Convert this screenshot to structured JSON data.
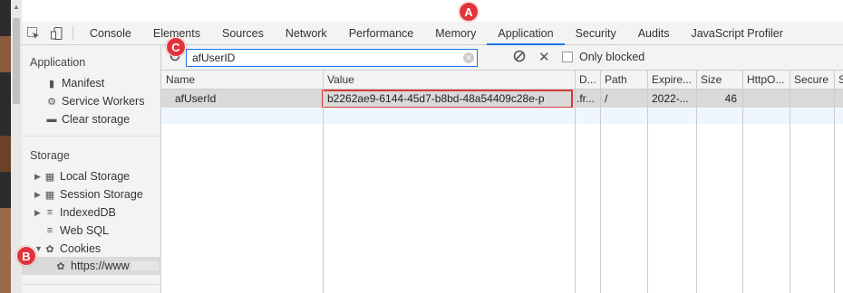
{
  "tabs": [
    "Console",
    "Elements",
    "Sources",
    "Network",
    "Performance",
    "Memory",
    "Application",
    "Security",
    "Audits",
    "JavaScript Profiler"
  ],
  "active_tab": "Application",
  "sidebar": {
    "application_title": "Application",
    "application_items": [
      "Manifest",
      "Service Workers",
      "Clear storage"
    ],
    "storage_title": "Storage",
    "storage_items": [
      "Local Storage",
      "Session Storage",
      "IndexedDB",
      "Web SQL",
      "Cookies"
    ],
    "cookie_origin": "https://www"
  },
  "filter": {
    "value": "afUserID",
    "only_blocked_label": "Only blocked"
  },
  "table": {
    "columns": [
      "Name",
      "Value",
      "D...",
      "Path",
      "Expire...",
      "Size",
      "HttpO...",
      "Secure",
      "S"
    ],
    "rows": [
      {
        "name": "afUserId",
        "value": "b2262ae9-6144-45d7-b8bd-48a54409c28e-p",
        "domain": ".fr...",
        "path": "/",
        "expires": "2022-...",
        "size": "46"
      }
    ]
  },
  "annotations": {
    "a": "A",
    "b": "B",
    "c": "C"
  },
  "colors": {
    "accent": "#1a73e8",
    "badge": "#e0333b",
    "highlight_border": "#d63a3a"
  },
  "icons": [
    "inspect-icon",
    "device-toggle-icon",
    "refresh-icon",
    "clear-filter-icon",
    "block-icon",
    "close-icon",
    "manifest-icon",
    "gear-icon",
    "trash-icon",
    "grid-icon",
    "database-icon",
    "cookie-icon"
  ]
}
